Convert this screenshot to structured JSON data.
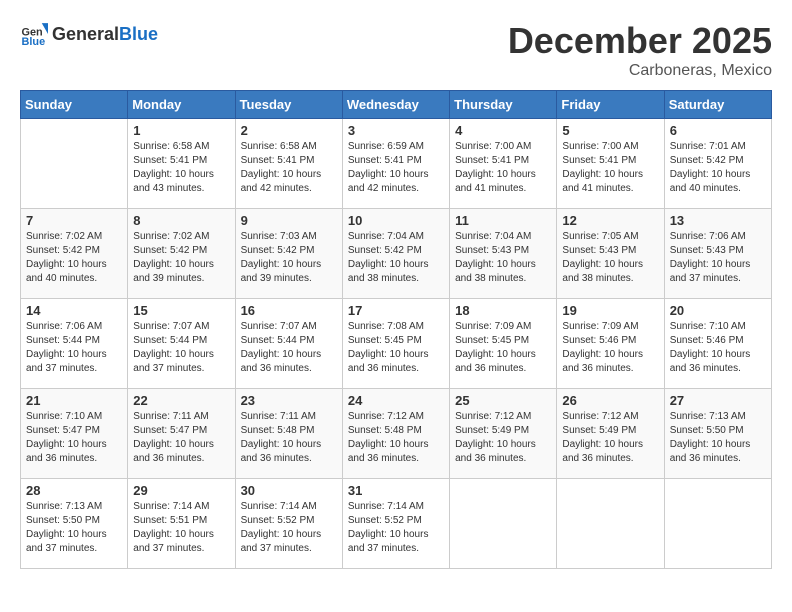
{
  "logo": {
    "text_general": "General",
    "text_blue": "Blue"
  },
  "header": {
    "month": "December 2025",
    "location": "Carboneras, Mexico"
  },
  "days_of_week": [
    "Sunday",
    "Monday",
    "Tuesday",
    "Wednesday",
    "Thursday",
    "Friday",
    "Saturday"
  ],
  "weeks": [
    [
      {
        "day": "",
        "info": ""
      },
      {
        "day": "1",
        "info": "Sunrise: 6:58 AM\nSunset: 5:41 PM\nDaylight: 10 hours\nand 43 minutes."
      },
      {
        "day": "2",
        "info": "Sunrise: 6:58 AM\nSunset: 5:41 PM\nDaylight: 10 hours\nand 42 minutes."
      },
      {
        "day": "3",
        "info": "Sunrise: 6:59 AM\nSunset: 5:41 PM\nDaylight: 10 hours\nand 42 minutes."
      },
      {
        "day": "4",
        "info": "Sunrise: 7:00 AM\nSunset: 5:41 PM\nDaylight: 10 hours\nand 41 minutes."
      },
      {
        "day": "5",
        "info": "Sunrise: 7:00 AM\nSunset: 5:41 PM\nDaylight: 10 hours\nand 41 minutes."
      },
      {
        "day": "6",
        "info": "Sunrise: 7:01 AM\nSunset: 5:42 PM\nDaylight: 10 hours\nand 40 minutes."
      }
    ],
    [
      {
        "day": "7",
        "info": "Sunrise: 7:02 AM\nSunset: 5:42 PM\nDaylight: 10 hours\nand 40 minutes."
      },
      {
        "day": "8",
        "info": "Sunrise: 7:02 AM\nSunset: 5:42 PM\nDaylight: 10 hours\nand 39 minutes."
      },
      {
        "day": "9",
        "info": "Sunrise: 7:03 AM\nSunset: 5:42 PM\nDaylight: 10 hours\nand 39 minutes."
      },
      {
        "day": "10",
        "info": "Sunrise: 7:04 AM\nSunset: 5:42 PM\nDaylight: 10 hours\nand 38 minutes."
      },
      {
        "day": "11",
        "info": "Sunrise: 7:04 AM\nSunset: 5:43 PM\nDaylight: 10 hours\nand 38 minutes."
      },
      {
        "day": "12",
        "info": "Sunrise: 7:05 AM\nSunset: 5:43 PM\nDaylight: 10 hours\nand 38 minutes."
      },
      {
        "day": "13",
        "info": "Sunrise: 7:06 AM\nSunset: 5:43 PM\nDaylight: 10 hours\nand 37 minutes."
      }
    ],
    [
      {
        "day": "14",
        "info": "Sunrise: 7:06 AM\nSunset: 5:44 PM\nDaylight: 10 hours\nand 37 minutes."
      },
      {
        "day": "15",
        "info": "Sunrise: 7:07 AM\nSunset: 5:44 PM\nDaylight: 10 hours\nand 37 minutes."
      },
      {
        "day": "16",
        "info": "Sunrise: 7:07 AM\nSunset: 5:44 PM\nDaylight: 10 hours\nand 36 minutes."
      },
      {
        "day": "17",
        "info": "Sunrise: 7:08 AM\nSunset: 5:45 PM\nDaylight: 10 hours\nand 36 minutes."
      },
      {
        "day": "18",
        "info": "Sunrise: 7:09 AM\nSunset: 5:45 PM\nDaylight: 10 hours\nand 36 minutes."
      },
      {
        "day": "19",
        "info": "Sunrise: 7:09 AM\nSunset: 5:46 PM\nDaylight: 10 hours\nand 36 minutes."
      },
      {
        "day": "20",
        "info": "Sunrise: 7:10 AM\nSunset: 5:46 PM\nDaylight: 10 hours\nand 36 minutes."
      }
    ],
    [
      {
        "day": "21",
        "info": "Sunrise: 7:10 AM\nSunset: 5:47 PM\nDaylight: 10 hours\nand 36 minutes."
      },
      {
        "day": "22",
        "info": "Sunrise: 7:11 AM\nSunset: 5:47 PM\nDaylight: 10 hours\nand 36 minutes."
      },
      {
        "day": "23",
        "info": "Sunrise: 7:11 AM\nSunset: 5:48 PM\nDaylight: 10 hours\nand 36 minutes."
      },
      {
        "day": "24",
        "info": "Sunrise: 7:12 AM\nSunset: 5:48 PM\nDaylight: 10 hours\nand 36 minutes."
      },
      {
        "day": "25",
        "info": "Sunrise: 7:12 AM\nSunset: 5:49 PM\nDaylight: 10 hours\nand 36 minutes."
      },
      {
        "day": "26",
        "info": "Sunrise: 7:12 AM\nSunset: 5:49 PM\nDaylight: 10 hours\nand 36 minutes."
      },
      {
        "day": "27",
        "info": "Sunrise: 7:13 AM\nSunset: 5:50 PM\nDaylight: 10 hours\nand 36 minutes."
      }
    ],
    [
      {
        "day": "28",
        "info": "Sunrise: 7:13 AM\nSunset: 5:50 PM\nDaylight: 10 hours\nand 37 minutes."
      },
      {
        "day": "29",
        "info": "Sunrise: 7:14 AM\nSunset: 5:51 PM\nDaylight: 10 hours\nand 37 minutes."
      },
      {
        "day": "30",
        "info": "Sunrise: 7:14 AM\nSunset: 5:52 PM\nDaylight: 10 hours\nand 37 minutes."
      },
      {
        "day": "31",
        "info": "Sunrise: 7:14 AM\nSunset: 5:52 PM\nDaylight: 10 hours\nand 37 minutes."
      },
      {
        "day": "",
        "info": ""
      },
      {
        "day": "",
        "info": ""
      },
      {
        "day": "",
        "info": ""
      }
    ]
  ]
}
